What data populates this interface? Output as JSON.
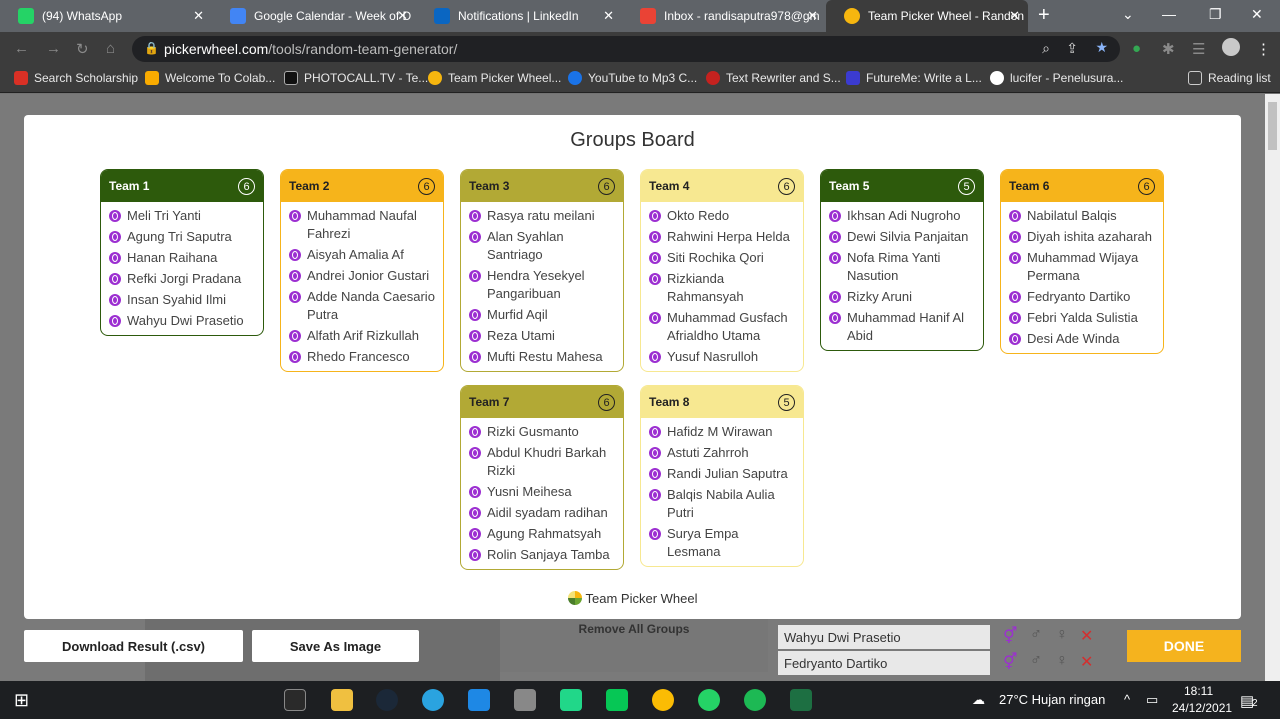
{
  "browser": {
    "tabs": [
      {
        "title": "(94) WhatsApp",
        "color": "#25d366"
      },
      {
        "title": "Google Calendar - Week of D",
        "color": "#4285f4"
      },
      {
        "title": "Notifications | LinkedIn",
        "color": "#0a66c2"
      },
      {
        "title": "Inbox - randisaputra978@gm",
        "color": "#ea4335"
      },
      {
        "title": "Team Picker Wheel - Randon",
        "color": "#f6b60f"
      }
    ],
    "url_domain": "pickerwheel.com",
    "url_path": "/tools/random-team-generator/",
    "bookmarks": [
      {
        "title": "Search Scholarship",
        "color": "#d93025"
      },
      {
        "title": "Welcome To Colab...",
        "color": "#f9ab00"
      },
      {
        "title": "PHOTOCALL.TV - Te...",
        "color": "#111111"
      },
      {
        "title": "Team Picker Wheel...",
        "color": "#f6b60f"
      },
      {
        "title": "YouTube to Mp3 C...",
        "color": "#1a73e8"
      },
      {
        "title": "Text Rewriter and S...",
        "color": "#c5221f"
      },
      {
        "title": "FutureMe: Write a L...",
        "color": "#3b3bd1"
      },
      {
        "title": "lucifer - Penelusura...",
        "color": "#ffffff"
      }
    ],
    "reading_list": "Reading list"
  },
  "modal": {
    "title": "Groups Board",
    "footer": "Team Picker Wheel",
    "teams": [
      {
        "name": "Team 1",
        "count": "6",
        "members": [
          "Meli Tri Yanti",
          "Agung Tri Saputra",
          "Hanan Raihana",
          "Refki Jorgi Pradana",
          "Insan Syahid Ilmi",
          "Wahyu Dwi Prasetio"
        ]
      },
      {
        "name": "Team 2",
        "count": "6",
        "members": [
          "Muhammad Naufal Fahrezi",
          "Aisyah Amalia Af",
          "Andrei Jonior Gustari",
          "Adde Nanda Caesario Putra",
          "Alfath Arif Rizkullah",
          "Rhedo Francesco"
        ]
      },
      {
        "name": "Team 3",
        "count": "6",
        "members": [
          "Rasya ratu meilani",
          "Alan Syahlan Santriago",
          "Hendra Yesekyel Pangaribuan",
          "Murfid Aqil",
          "Reza Utami",
          "Mufti Restu Mahesa"
        ]
      },
      {
        "name": "Team 4",
        "count": "6",
        "members": [
          "Okto Redo",
          "Rahwini Herpa Helda",
          "Siti Rochika Qori",
          "Rizkianda Rahmansyah",
          "Muhammad Gusfach Afrialdho Utama",
          "Yusuf Nasrulloh"
        ]
      },
      {
        "name": "Team 5",
        "count": "5",
        "members": [
          "Ikhsan Adi Nugroho",
          "Dewi Silvia Panjaitan",
          "Nofa Rima Yanti Nasution",
          "Rizky Aruni",
          "Muhammad Hanif Al Abid"
        ]
      },
      {
        "name": "Team 6",
        "count": "6",
        "members": [
          "Nabilatul Balqis",
          "Diyah ishita azaharah",
          "Muhammad Wijaya Permana",
          "Fedryanto Dartiko",
          "Febri Yalda Sulistia",
          "Desi Ade Winda"
        ]
      },
      {
        "name": "Team 7",
        "count": "6",
        "members": [
          "Rizki Gusmanto",
          "Abdul Khudri Barkah Rizki",
          "Yusni Meihesa",
          "Aidil syadam radihan",
          "Agung Rahmatsyah",
          "Rolin Sanjaya Tamba"
        ]
      },
      {
        "name": "Team 8",
        "count": "5",
        "members": [
          "Hafidz M Wirawan",
          "Astuti Zahrroh",
          "Randi Julian Saputra",
          "Balqis Nabila Aulia Putri",
          "Surya Empa Lesmana"
        ]
      }
    ]
  },
  "bottom": {
    "download_label": "Download Result (.csv)",
    "save_label": "Save As Image",
    "done_label": "DONE",
    "remove_all": "Remove All Groups",
    "bg_rows": [
      "Wahyu Dwi Prasetio",
      "Fedryanto Dartiko"
    ]
  },
  "taskbar": {
    "weather": "27°C  Hujan ringan",
    "time": "18:11",
    "date": "24/12/2021",
    "notif_count": "2"
  }
}
